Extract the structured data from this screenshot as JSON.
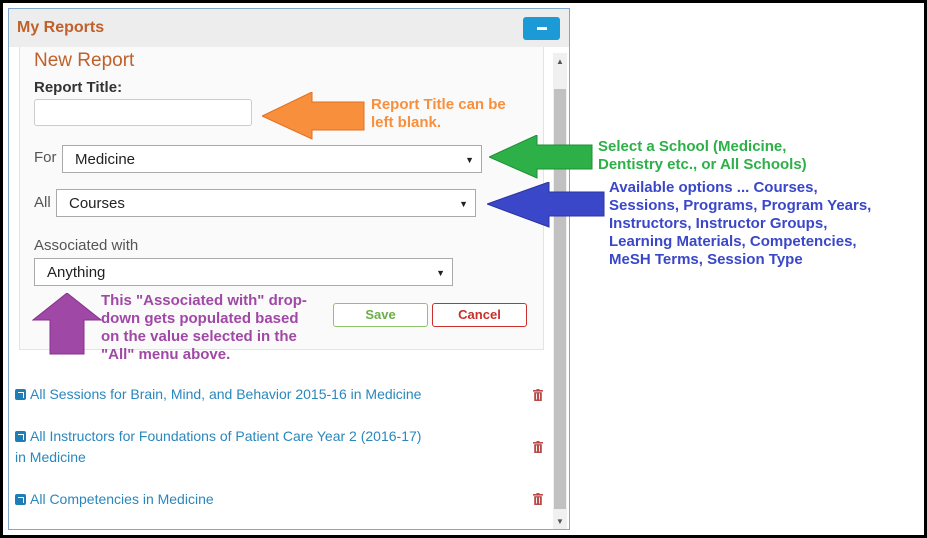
{
  "panel": {
    "title": "My Reports",
    "collapse_icon": "minus-icon"
  },
  "form": {
    "heading": "New Report",
    "report_title_label": "Report Title:",
    "report_title_value": "",
    "for_label": "For",
    "school_value": "Medicine",
    "all_label": "All",
    "subject_value": "Courses",
    "associated_label": "Associated with",
    "associated_value": "Anything",
    "save_label": "Save",
    "cancel_label": "Cancel"
  },
  "reports": [
    {
      "line1": "All Sessions for Brain, Mind, and Behavior 2015-16 in Medicine",
      "line2": ""
    },
    {
      "line1": "All Instructors for Foundations of Patient Care Year 2 (2016-17)",
      "line2": "in Medicine"
    },
    {
      "line1": "All Competencies in Medicine",
      "line2": ""
    }
  ],
  "annotations": {
    "title_note": [
      "Report Title can be",
      "left blank."
    ],
    "school_note": [
      "Select a School (Medicine,",
      "Dentistry etc., or All Schools)"
    ],
    "options_note": [
      "Available options ... Courses,",
      "Sessions, Programs, Program Years,",
      "Instructors, Instructor Groups,",
      "Learning Materials, Competencies,",
      "MeSH Terms, Session Type"
    ],
    "assoc_note": [
      "This \"Associated with\" drop-",
      "down gets populated based",
      "on the value selected in the",
      "\"All\" menu above."
    ]
  },
  "colors": {
    "orange": "#f78f3d",
    "green": "#2db048",
    "blue": "#3b47c9",
    "purple": "#a048a6"
  }
}
